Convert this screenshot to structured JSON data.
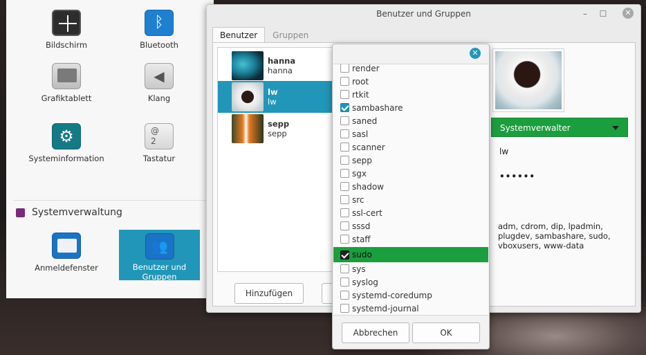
{
  "settings": {
    "tiles": [
      {
        "label": "Bildschirm",
        "icon": "display-icon"
      },
      {
        "label": "Bluetooth",
        "icon": "bluetooth-icon",
        "glyph": "ᛒ"
      },
      {
        "label": "Grafiktablett",
        "icon": "tablet-icon"
      },
      {
        "label": "Klang",
        "icon": "sound-icon",
        "glyph": "◀"
      },
      {
        "label": "Systeminformation",
        "icon": "gear-icon",
        "glyph": "⚙"
      },
      {
        "label": "Tastatur",
        "icon": "keyboard-icon",
        "glyph": "@\n2"
      }
    ],
    "section_title": "Systemverwaltung",
    "admin_tiles": [
      {
        "label": "Anmeldefenster",
        "icon": "login-window-icon"
      },
      {
        "label": "Benutzer und Gruppen",
        "icon": "users-icon",
        "glyph": "👥"
      }
    ]
  },
  "dialog": {
    "title": "Benutzer und Gruppen",
    "tabs": {
      "users": "Benutzer",
      "groups": "Gruppen"
    },
    "users": [
      {
        "name": "hanna",
        "login": "hanna"
      },
      {
        "name": "lw",
        "login": "lw"
      },
      {
        "name": "sepp",
        "login": "sepp"
      }
    ],
    "add_button": "Hinzufügen",
    "account_type": "Systemverwalter",
    "username_value": "lw",
    "password_value": "••••••",
    "groups_value": "adm, cdrom, dip, lpadmin, plugdev, sambashare, sudo, vboxusers, www-data"
  },
  "popup": {
    "groups": [
      {
        "name": "render",
        "checked": false
      },
      {
        "name": "root",
        "checked": false
      },
      {
        "name": "rtkit",
        "checked": false
      },
      {
        "name": "sambashare",
        "checked": true
      },
      {
        "name": "saned",
        "checked": false
      },
      {
        "name": "sasl",
        "checked": false
      },
      {
        "name": "scanner",
        "checked": false
      },
      {
        "name": "sepp",
        "checked": false
      },
      {
        "name": "sgx",
        "checked": false
      },
      {
        "name": "shadow",
        "checked": false
      },
      {
        "name": "src",
        "checked": false
      },
      {
        "name": "ssl-cert",
        "checked": false
      },
      {
        "name": "sssd",
        "checked": false
      },
      {
        "name": "staff",
        "checked": false
      },
      {
        "name": "sudo",
        "checked": true,
        "highlighted": true
      },
      {
        "name": "sys",
        "checked": false
      },
      {
        "name": "syslog",
        "checked": false
      },
      {
        "name": "systemd-coredump",
        "checked": false
      },
      {
        "name": "systemd-journal",
        "checked": false
      }
    ],
    "cancel_label": "Abbrechen",
    "ok_label": "OK"
  },
  "colors": {
    "selection_blue": "#2196b8",
    "admin_green": "#1b9e3e"
  }
}
